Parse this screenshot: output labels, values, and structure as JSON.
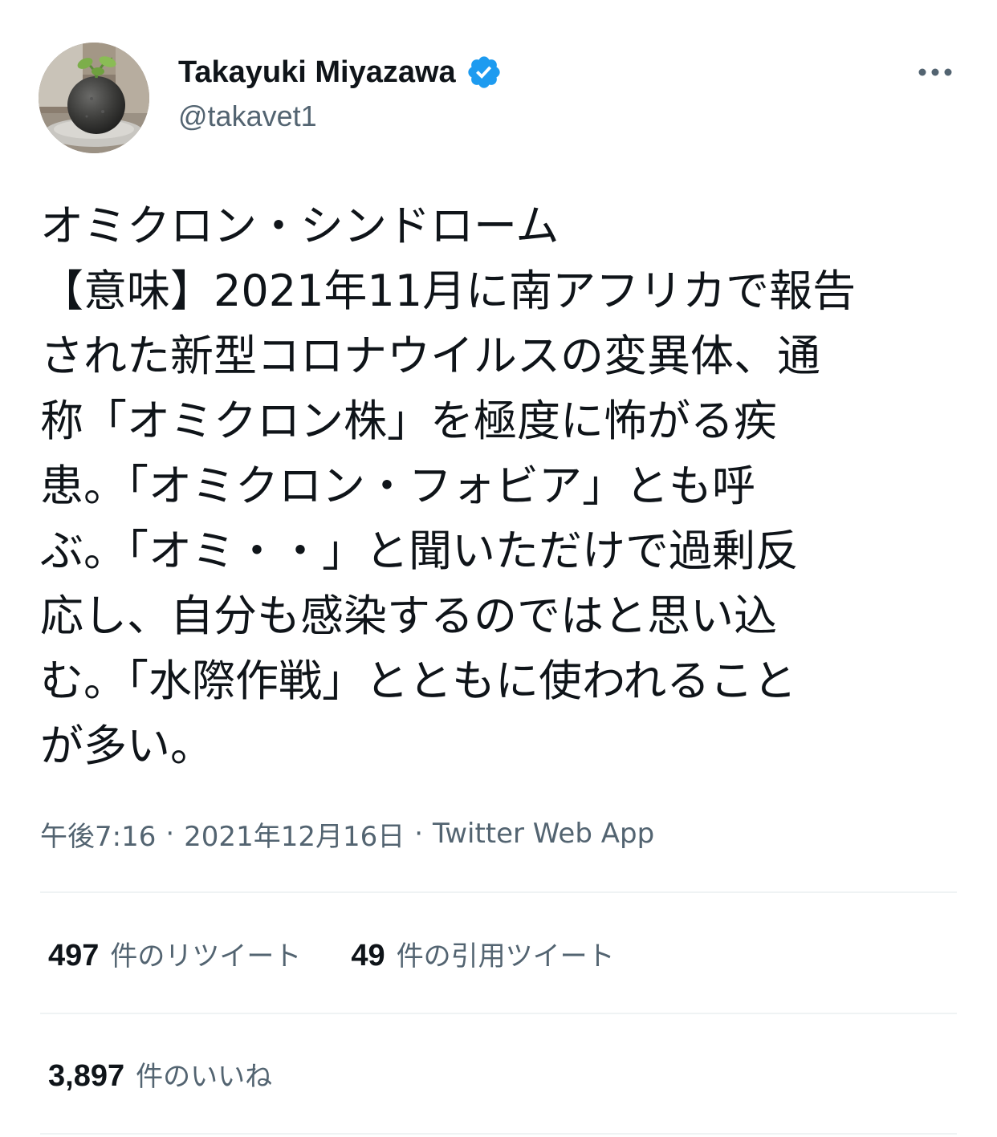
{
  "author": {
    "display_name": "Takayuki Miyazawa",
    "handle": "@takavet1",
    "verified": true
  },
  "icons": {
    "more": "more-horizontal-icon",
    "verified": "verified-badge-icon",
    "avatar": "profile-avatar-image"
  },
  "tweet": {
    "text_lines": [
      "オミクロン・シンドローム",
      "【意味】2021年11月に南アフリカで報告",
      "された新型コロナウイルスの変異体、通",
      "称「オミクロン株」を極度に怖がる疾",
      "患。「オミクロン・フォビア」とも呼",
      "ぶ。「オミ・・」と聞いただけで過剰反",
      "応し、自分も感染するのではと思い込",
      "む。「水際作戦」とともに使われること",
      "が多い。"
    ]
  },
  "meta": {
    "time": "午後7:16",
    "separator": "·",
    "date": "2021年12月16日",
    "source": "Twitter Web App"
  },
  "stats": {
    "retweets_count": "497",
    "retweets_label": "件のリツイート",
    "quotes_count": "49",
    "quotes_label": "件の引用ツイート",
    "likes_count": "3,897",
    "likes_label": "件のいいね"
  },
  "colors": {
    "text_primary": "#0f1419",
    "text_secondary": "#536471",
    "verified_blue": "#1d9bf0",
    "divider": "#eff3f4"
  }
}
